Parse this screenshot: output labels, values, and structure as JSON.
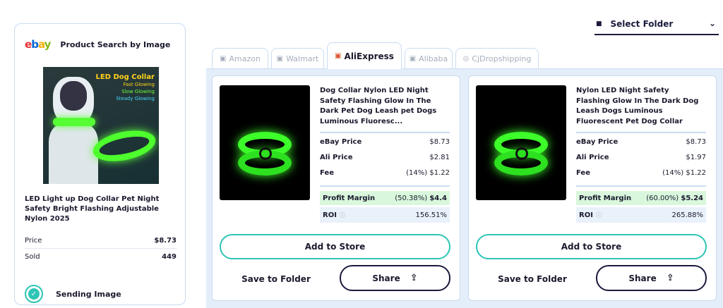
{
  "left_panel": {
    "brand": {
      "e": "e",
      "b": "b",
      "a": "a",
      "y": "y"
    },
    "title": "Product Search by Image",
    "image_text": {
      "heading": "LED Dog Collar",
      "line1": "Fast Glowing",
      "line2": "Slow Glowing",
      "line3": "Steady Glowing"
    },
    "product_title": "LED Light up Dog Collar Pet Night Safety Bright Flashing Adjustable Nylon 2025",
    "price_label": "Price",
    "price_value": "$8.73",
    "sold_label": "Sold",
    "sold_value": "449",
    "status": "Sending Image",
    "status_icon": "✓"
  },
  "folder_select": {
    "icon": "■",
    "label": "Select Folder",
    "chevron": "⌄"
  },
  "tabs": [
    {
      "label": "Amazon",
      "icon": "▣"
    },
    {
      "label": "Walmart",
      "icon": "▣"
    },
    {
      "label": "AliExpress",
      "icon": "▣"
    },
    {
      "label": "Alibaba",
      "icon": "▣"
    },
    {
      "label": "CjDropshipping",
      "icon": "◎"
    }
  ],
  "cards": [
    {
      "title": "Dog Collar Nylon LED Night Safety Flashing Glow In The Dark Pet Dog Leash pet Dogs Luminous Fluoresc...",
      "ebay_price_label": "eBay Price",
      "ebay_price": "$8.73",
      "ali_price_label": "Ali Price",
      "ali_price": "$2.81",
      "fee_label": "Fee",
      "fee": "(14%) $1.22",
      "profit_label": "Profit Margin",
      "profit_pct": "(50.38%)",
      "profit_value": "$4.4",
      "roi_label": "ROI",
      "roi_info": "ⓘ",
      "roi_value": "156.51%",
      "add_label": "Add to Store",
      "save_label": "Save to Folder",
      "share_label": "Share",
      "share_icon": "⇪"
    },
    {
      "title": "Nylon LED Night Safety Flashing Glow In The Dark Dog Leash Dogs Luminous Fluorescent Pet Dog Collar",
      "ebay_price_label": "eBay Price",
      "ebay_price": "$8.73",
      "ali_price_label": "Ali Price",
      "ali_price": "$1.97",
      "fee_label": "Fee",
      "fee": "(14%) $1.22",
      "profit_label": "Profit Margin",
      "profit_pct": "(60.00%)",
      "profit_value": "$5.24",
      "roi_label": "ROI",
      "roi_info": "ⓘ",
      "roi_value": "265.88%",
      "add_label": "Add to Store",
      "save_label": "Save to Folder",
      "share_label": "Share",
      "share_icon": "⇪"
    }
  ]
}
